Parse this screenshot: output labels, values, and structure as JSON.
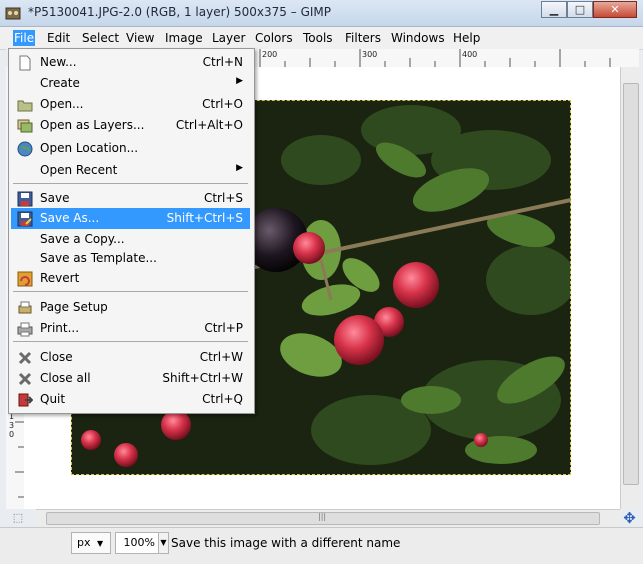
{
  "window": {
    "title": "*P5130041.JPG-2.0 (RGB, 1 layer) 500x375 – GIMP",
    "minimize_label": "▁",
    "maximize_label": "□",
    "close_label": "✕",
    "app_icon": "gimp-icon"
  },
  "menubar": {
    "items": [
      "File",
      "Edit",
      "Select",
      "View",
      "Image",
      "Layer",
      "Colors",
      "Tools",
      "Filters",
      "Windows",
      "Help"
    ],
    "active": "File"
  },
  "ruler": {
    "top_labels": [
      "200",
      "300",
      "400"
    ],
    "left_labels": [
      "1",
      "3",
      "0"
    ]
  },
  "file_menu": {
    "items": [
      {
        "label": "New...",
        "shortcut": "Ctrl+N",
        "icon": "new-document-icon"
      },
      {
        "label": "Create",
        "shortcut": "",
        "submenu": true,
        "icon": ""
      },
      {
        "label": "Open...",
        "shortcut": "Ctrl+O",
        "icon": "open-folder-icon"
      },
      {
        "label": "Open as Layers...",
        "shortcut": "Ctrl+Alt+O",
        "icon": "open-as-layers-icon"
      },
      {
        "label": "Open Location...",
        "shortcut": "",
        "icon": "globe-icon"
      },
      {
        "label": "Open Recent",
        "shortcut": "",
        "submenu": true,
        "icon": ""
      },
      {
        "label": "Save",
        "shortcut": "Ctrl+S",
        "icon": "floppy-disk-icon"
      },
      {
        "label": "Save As...",
        "shortcut": "Shift+Ctrl+S",
        "icon": "save-as-icon",
        "highlighted": true
      },
      {
        "label": "Save a Copy...",
        "shortcut": "",
        "icon": ""
      },
      {
        "label": "Save as Template...",
        "shortcut": "",
        "icon": ""
      },
      {
        "label": "Revert",
        "shortcut": "",
        "icon": "revert-icon"
      },
      {
        "label": "Page Setup",
        "shortcut": "",
        "icon": "page-setup-icon"
      },
      {
        "label": "Print...",
        "shortcut": "Ctrl+P",
        "icon": "printer-icon"
      },
      {
        "label": "Close",
        "shortcut": "Ctrl+W",
        "icon": "close-x-icon"
      },
      {
        "label": "Close all",
        "shortcut": "Shift+Ctrl+W",
        "icon": "close-all-icon"
      },
      {
        "label": "Quit",
        "shortcut": "Ctrl+Q",
        "icon": "quit-icon"
      }
    ]
  },
  "statusbar": {
    "unit": "px",
    "zoom": "100%",
    "message": "Save this image with a different name"
  },
  "colors": {
    "highlight": "#3399ff",
    "selection_dash": "#d4c53a"
  }
}
